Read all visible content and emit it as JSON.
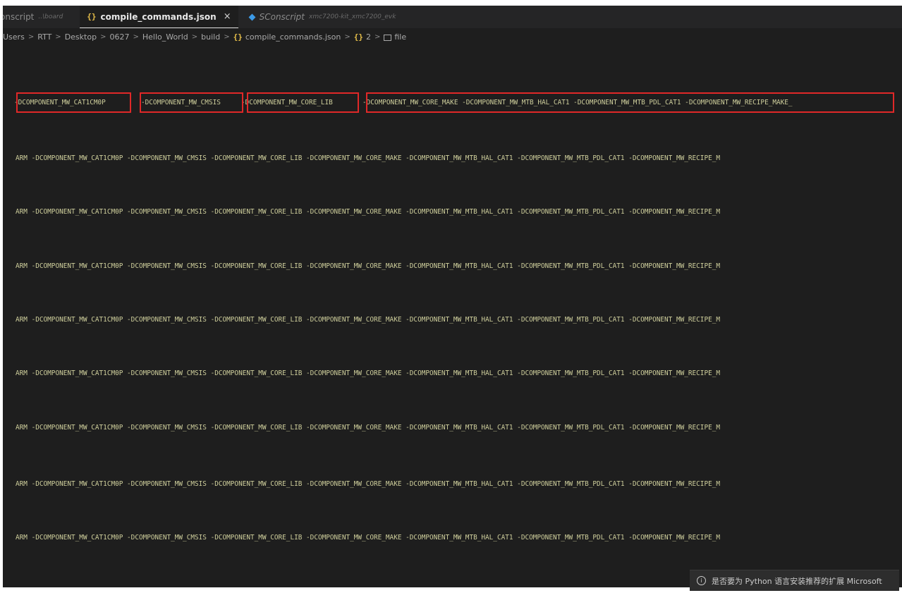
{
  "tabs": [
    {
      "label": "onscript",
      "description": "..\\board",
      "active": false
    },
    {
      "label": "compile_commands.json",
      "close": "×",
      "active": true
    },
    {
      "label": "SConscript",
      "description": "xmc7200-kit_xmc7200_evk",
      "active": false
    }
  ],
  "breadcrumb": {
    "items": [
      "Users",
      "RTT",
      "Desktop",
      "0627",
      "Hello_World",
      "build"
    ],
    "file": "compile_commands.json",
    "array_index": "2",
    "field": "file",
    "separator": ">",
    "braces": "{}"
  },
  "editor": {
    "first_line": {
      "segments": [
        "-DCOMPONENT_MW_CAT1CM0P",
        "-DCOMPONENT_MW_CMSIS",
        "-DCOMPONENT_MW_CORE_LIB",
        "-DCOMPONENT_MW_CORE_MAKE -DCOMPONENT_MW_MTB_HAL_CAT1 -DCOMPONENT_MW_MTB_PDL_CAT1 -DCOMPONENT_MW_RECIPE_MAKE_"
      ]
    },
    "lines": [
      "ARM -DCOMPONENT_MW_CAT1CM0P -DCOMPONENT_MW_CMSIS -DCOMPONENT_MW_CORE_LIB -DCOMPONENT_MW_CORE_MAKE -DCOMPONENT_MW_MTB_HAL_CAT1 -DCOMPONENT_MW_MTB_PDL_CAT1 -DCOMPONENT_MW_RECIPE_M",
      "ARM -DCOMPONENT_MW_CAT1CM0P -DCOMPONENT_MW_CMSIS -DCOMPONENT_MW_CORE_LIB -DCOMPONENT_MW_CORE_MAKE -DCOMPONENT_MW_MTB_HAL_CAT1 -DCOMPONENT_MW_MTB_PDL_CAT1 -DCOMPONENT_MW_RECIPE_M",
      "ARM -DCOMPONENT_MW_CAT1CM0P -DCOMPONENT_MW_CMSIS -DCOMPONENT_MW_CORE_LIB -DCOMPONENT_MW_CORE_MAKE -DCOMPONENT_MW_MTB_HAL_CAT1 -DCOMPONENT_MW_MTB_PDL_CAT1 -DCOMPONENT_MW_RECIPE_M",
      "ARM -DCOMPONENT_MW_CAT1CM0P -DCOMPONENT_MW_CMSIS -DCOMPONENT_MW_CORE_LIB -DCOMPONENT_MW_CORE_MAKE -DCOMPONENT_MW_MTB_HAL_CAT1 -DCOMPONENT_MW_MTB_PDL_CAT1 -DCOMPONENT_MW_RECIPE_M",
      "ARM -DCOMPONENT_MW_CAT1CM0P -DCOMPONENT_MW_CMSIS -DCOMPONENT_MW_CORE_LIB -DCOMPONENT_MW_CORE_MAKE -DCOMPONENT_MW_MTB_HAL_CAT1 -DCOMPONENT_MW_MTB_PDL_CAT1 -DCOMPONENT_MW_RECIPE_M",
      "ARM -DCOMPONENT_MW_CAT1CM0P -DCOMPONENT_MW_CMSIS -DCOMPONENT_MW_CORE_LIB -DCOMPONENT_MW_CORE_MAKE -DCOMPONENT_MW_MTB_HAL_CAT1 -DCOMPONENT_MW_MTB_PDL_CAT1 -DCOMPONENT_MW_RECIPE_M",
      "ARM -DCOMPONENT_MW_CAT1CM0P -DCOMPONENT_MW_CMSIS -DCOMPONENT_MW_CORE_LIB -DCOMPONENT_MW_CORE_MAKE -DCOMPONENT_MW_MTB_HAL_CAT1 -DCOMPONENT_MW_MTB_PDL_CAT1 -DCOMPONENT_MW_RECIPE_M",
      "ARM -DCOMPONENT_MW_CAT1CM0P -DCOMPONENT_MW_CMSIS -DCOMPONENT_MW_CORE_LIB -DCOMPONENT_MW_CORE_MAKE -DCOMPONENT_MW_MTB_HAL_CAT1 -DCOMPONENT_MW_MTB_PDL_CAT1 -DCOMPONENT_MW_RECIPE_M"
    ]
  },
  "notification": {
    "text": "是否要为 Python 语言安装推荐的扩展 Microsoft"
  },
  "colors": {
    "editor_bg": "#1e1e1e",
    "code_text": "#cfcf9c",
    "highlight_box": "#e02828",
    "json_icon": "#e8c04a"
  }
}
